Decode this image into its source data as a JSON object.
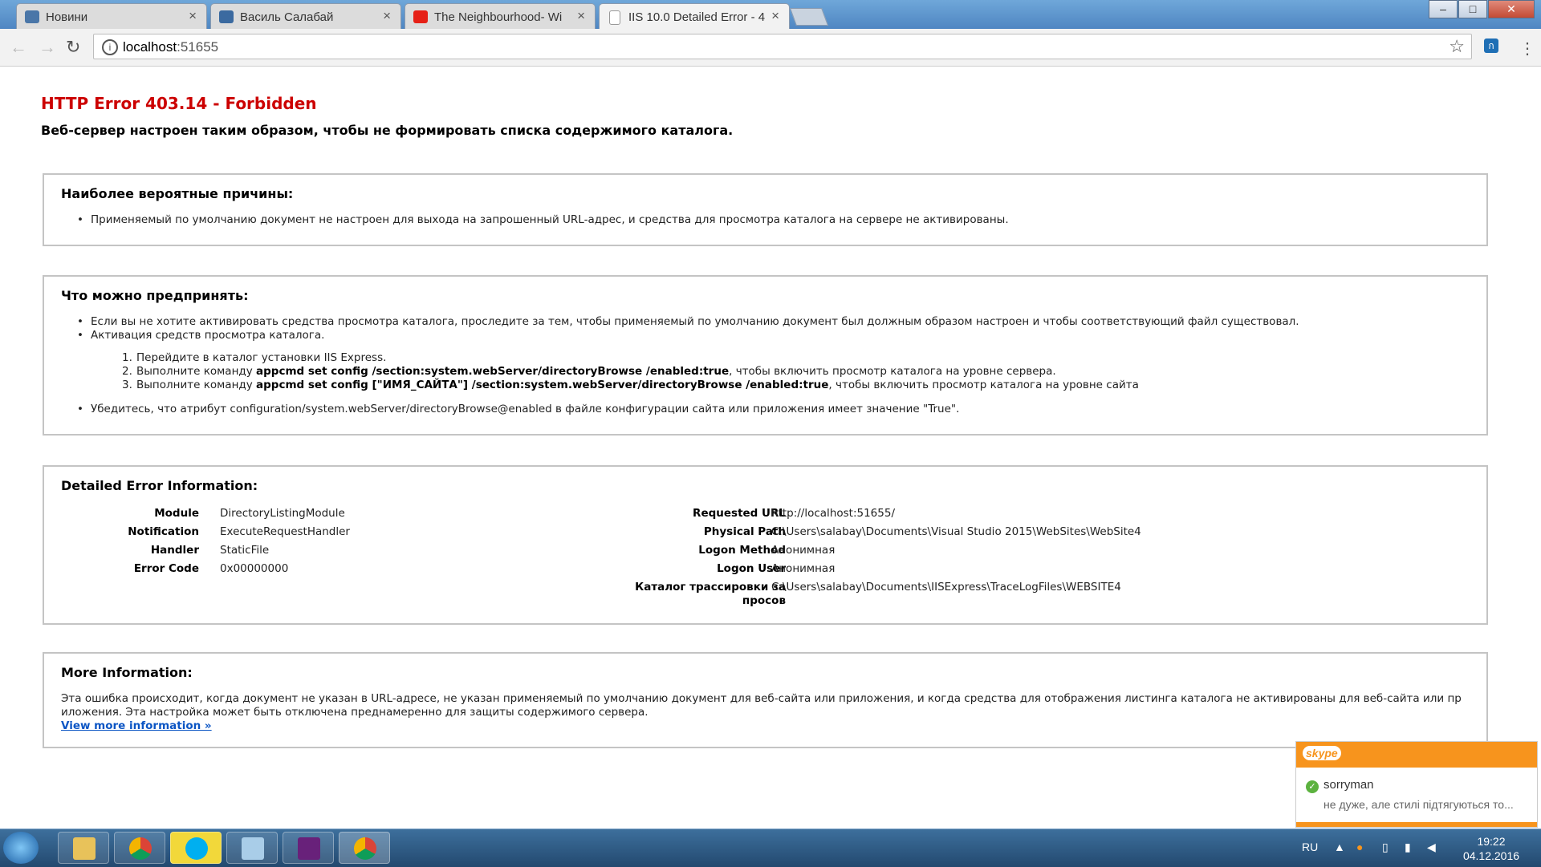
{
  "tabs": [
    {
      "title": "Новини",
      "favicon_color": "#4a76a8",
      "favicon": "vk-icon"
    },
    {
      "title": "Василь Салабай",
      "favicon_color": "#3b6aa0",
      "favicon": "pause-icon"
    },
    {
      "title": "The Neighbourhood- Wi",
      "favicon_color": "#e62117",
      "favicon": "youtube-icon"
    },
    {
      "title": "IIS 10.0 Detailed Error - 4",
      "favicon_color": "#ffffff",
      "favicon": "document-icon"
    }
  ],
  "address": {
    "host": "localhost",
    "port": ":51655"
  },
  "page": {
    "title": "HTTP Error 403.14 - Forbidden",
    "subtitle": "Веб-сервер настроен таким образом, чтобы не формировать списка содержимого каталога.",
    "causes": {
      "heading": "Наиболее вероятные причины:",
      "items": [
        "Применяемый по умолчанию документ не настроен для выхода на запрошенный URL-адрес, и средства для просмотра каталога на сервере не активированы."
      ]
    },
    "actions": {
      "heading": "Что можно предпринять:",
      "item1": "Если вы не хотите активировать средства просмотра каталога, проследите за тем, чтобы применяемый по умолчанию документ был должным образом настроен и чтобы соответствующий файл существовал.",
      "item2": "Активация средств просмотра каталога.",
      "step1": "Перейдите в каталог установки IIS Express.",
      "step2_pre": "Выполните команду ",
      "step2_cmd": "appcmd set config /section:system.webServer/directoryBrowse /enabled:true",
      "step2_post": ", чтобы включить просмотр каталога на уровне сервера.",
      "step3_pre": "Выполните команду ",
      "step3_cmd": "appcmd set config [\"ИМЯ_САЙТА\"] /section:system.webServer/directoryBrowse /enabled:true",
      "step3_post": ", чтобы включить просмотр каталога на уровне сайта",
      "item3": "Убедитесь, что атрибут configuration/system.webServer/directoryBrowse@enabled в файле конфигурации сайта или приложения имеет значение \"True\"."
    },
    "details": {
      "heading": "Detailed Error Information:",
      "left": [
        {
          "label": "Module",
          "value": "DirectoryListingModule"
        },
        {
          "label": "Notification",
          "value": "ExecuteRequestHandler"
        },
        {
          "label": "Handler",
          "value": "StaticFile"
        },
        {
          "label": "Error Code",
          "value": "0x00000000"
        }
      ],
      "right": [
        {
          "label": "Requested URL",
          "value": "http://localhost:51655/"
        },
        {
          "label": "Physical Path",
          "value": "C:\\Users\\salabay\\Documents\\Visual Studio 2015\\WebSites\\WebSite4"
        },
        {
          "label": "Logon Method",
          "value": "Анонимная"
        },
        {
          "label": "Logon User",
          "value": "Анонимная"
        },
        {
          "label": "Каталог трассировки за просов",
          "value": "C:\\Users\\salabay\\Documents\\IISExpress\\TraceLogFiles\\WEBSITE4"
        }
      ]
    },
    "more": {
      "heading": "More Information:",
      "text": "Эта ошибка происходит, когда документ не указан в URL-адресе, не указан применяемый по умолчанию документ для веб-сайта или приложения, и когда средства для отображения листинга каталога не активированы для веб-сайта или пр иложения. Эта настройка может быть отключена преднамеренно для защиты содержимого сервера.",
      "link": "View more information »"
    }
  },
  "skype": {
    "logo": "skype",
    "name": "sorryman",
    "message": "не дуже, але стилі підтягуються то..."
  },
  "taskbar": {
    "lang": "RU",
    "time": "19:22",
    "date": "04.12.2016"
  }
}
